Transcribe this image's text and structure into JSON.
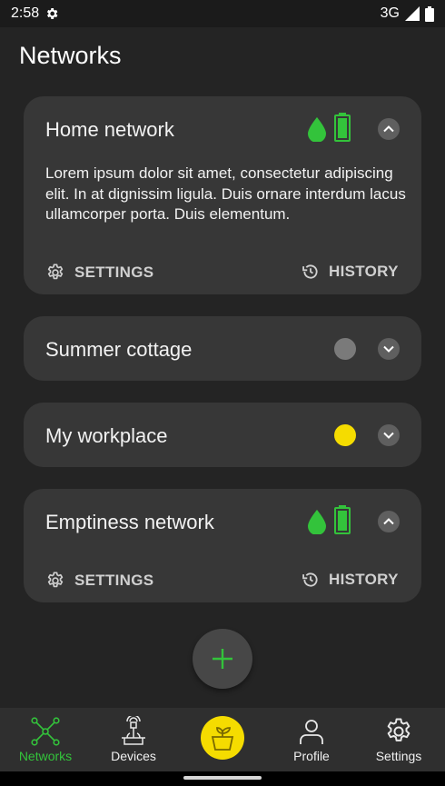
{
  "status_bar": {
    "time": "2:58",
    "network": "3G"
  },
  "page": {
    "title": "Networks"
  },
  "networks": [
    {
      "title": "Home network",
      "expanded": true,
      "description": "Lorem ipsum dolor sit amet, consectetur adipiscing elit. In at dignissim ligula. Duis ornare interdum lacus ullamcorper porta. Duis elementum.",
      "indicators": [
        "water-drop-icon",
        "battery-icon"
      ],
      "settings_label": "SETTINGS",
      "history_label": "HISTORY"
    },
    {
      "title": "Summer cottage",
      "expanded": false,
      "status_color": "#7a7a7a"
    },
    {
      "title": "My workplace",
      "expanded": false,
      "status_color": "#f5dc00"
    },
    {
      "title": "Emptiness network",
      "expanded": true,
      "indicators": [
        "water-drop-icon",
        "battery-icon"
      ],
      "settings_label": "SETTINGS",
      "history_label": "HISTORY"
    }
  ],
  "fab": {
    "icon": "plus-icon",
    "color": "#33c33b"
  },
  "bottom_nav": {
    "items": [
      {
        "label": "Networks",
        "icon": "network-icon",
        "active": true
      },
      {
        "label": "Devices",
        "icon": "devices-icon",
        "active": false
      },
      {
        "label": "",
        "icon": "plant-pot-icon",
        "active": false
      },
      {
        "label": "Profile",
        "icon": "person-icon",
        "active": false
      },
      {
        "label": "Settings",
        "icon": "gear-icon",
        "active": false
      }
    ]
  },
  "colors": {
    "accent_green": "#33c33b",
    "accent_yellow": "#f5dc00",
    "card": "#373737",
    "background": "#242424"
  }
}
